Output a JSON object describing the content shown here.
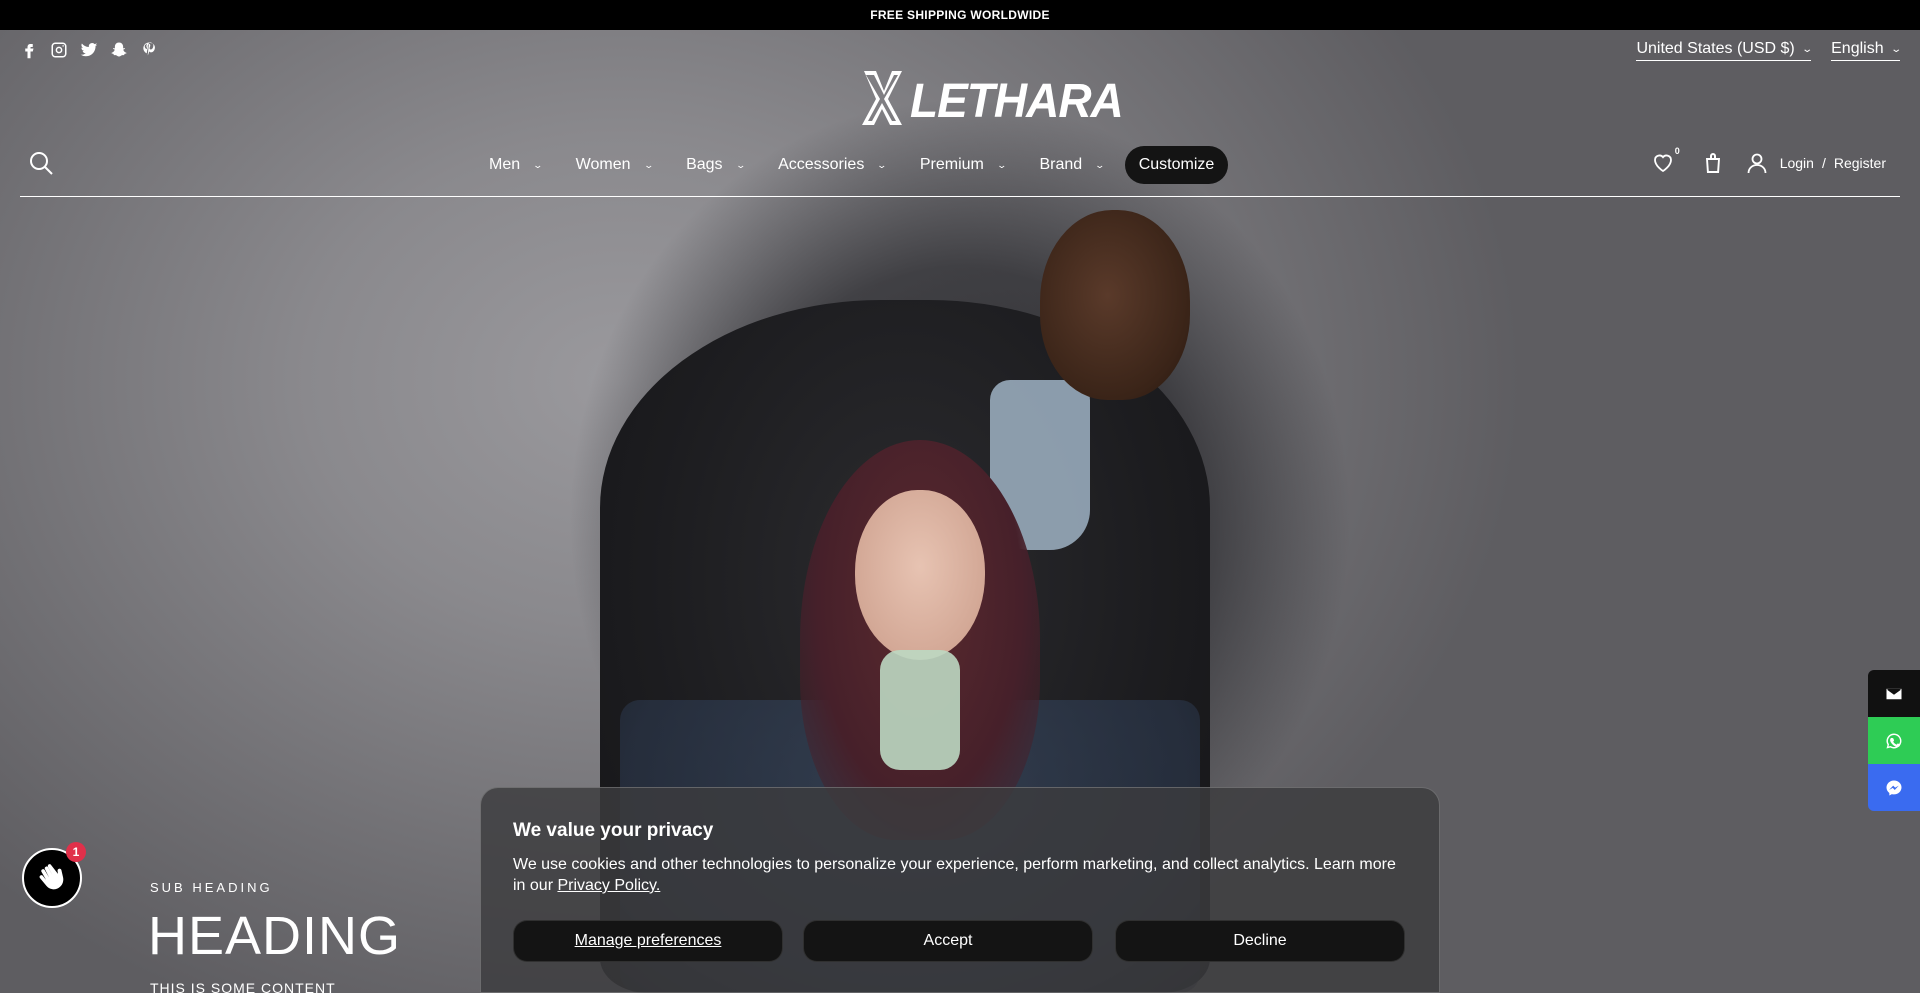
{
  "announcement": "FREE SHIPPING WORLDWIDE",
  "brand": {
    "name": "LETHARA"
  },
  "social": [
    "facebook-icon",
    "instagram-icon",
    "twitter-icon",
    "snapchat-icon",
    "pinterest-icon"
  ],
  "locale": {
    "currency": "United States (USD $)",
    "language": "English"
  },
  "nav": {
    "items": [
      {
        "label": "Men"
      },
      {
        "label": "Women"
      },
      {
        "label": "Bags"
      },
      {
        "label": "Accessories"
      },
      {
        "label": "Premium"
      },
      {
        "label": "Brand"
      }
    ],
    "customize": "Customize"
  },
  "header": {
    "wishlist_count": "0",
    "login": "Login",
    "separator": "/",
    "register": "Register"
  },
  "hero": {
    "sub_heading": "SUB HEADING",
    "heading": "HEADING",
    "content": "THIS IS SOME CONTENT"
  },
  "chat": {
    "badge": "1"
  },
  "cookie": {
    "title": "We value your privacy",
    "text": "We use cookies and other technologies to personalize your experience, perform marketing, and collect analytics. Learn more in our ",
    "link": "Privacy Policy.",
    "manage": "Manage preferences",
    "accept": "Accept",
    "decline": "Decline"
  },
  "colors": {
    "whatsapp": "#2ecc55",
    "messenger": "#3a6bf0",
    "badge": "#e0304a"
  }
}
